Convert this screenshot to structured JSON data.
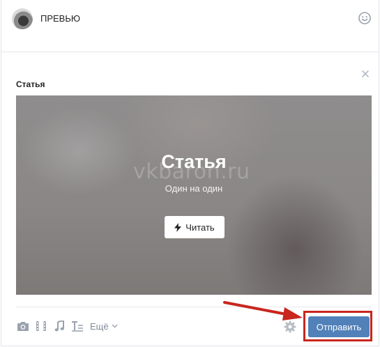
{
  "composer": {
    "text": "ПРЕВЬЮ",
    "avatar_icon": "user-avatar",
    "emoji_icon": "smile-icon"
  },
  "attachment": {
    "section_title": "Статья",
    "close_icon": "close-icon",
    "card": {
      "title": "Статья",
      "subtitle": "Один на один",
      "read_button": "Читать",
      "read_icon": "lightning-icon"
    },
    "watermark": "vkbaron.ru"
  },
  "toolbar": {
    "items": [
      {
        "icon": "camera-icon"
      },
      {
        "icon": "video-icon"
      },
      {
        "icon": "music-icon"
      },
      {
        "icon": "article-icon"
      }
    ],
    "more_label": "Ещё",
    "settings_icon": "gear-icon",
    "send_label": "Отправить"
  },
  "colors": {
    "accent": "#5181b8",
    "highlight": "#c8261e",
    "icon_gray": "#99a2ad"
  }
}
